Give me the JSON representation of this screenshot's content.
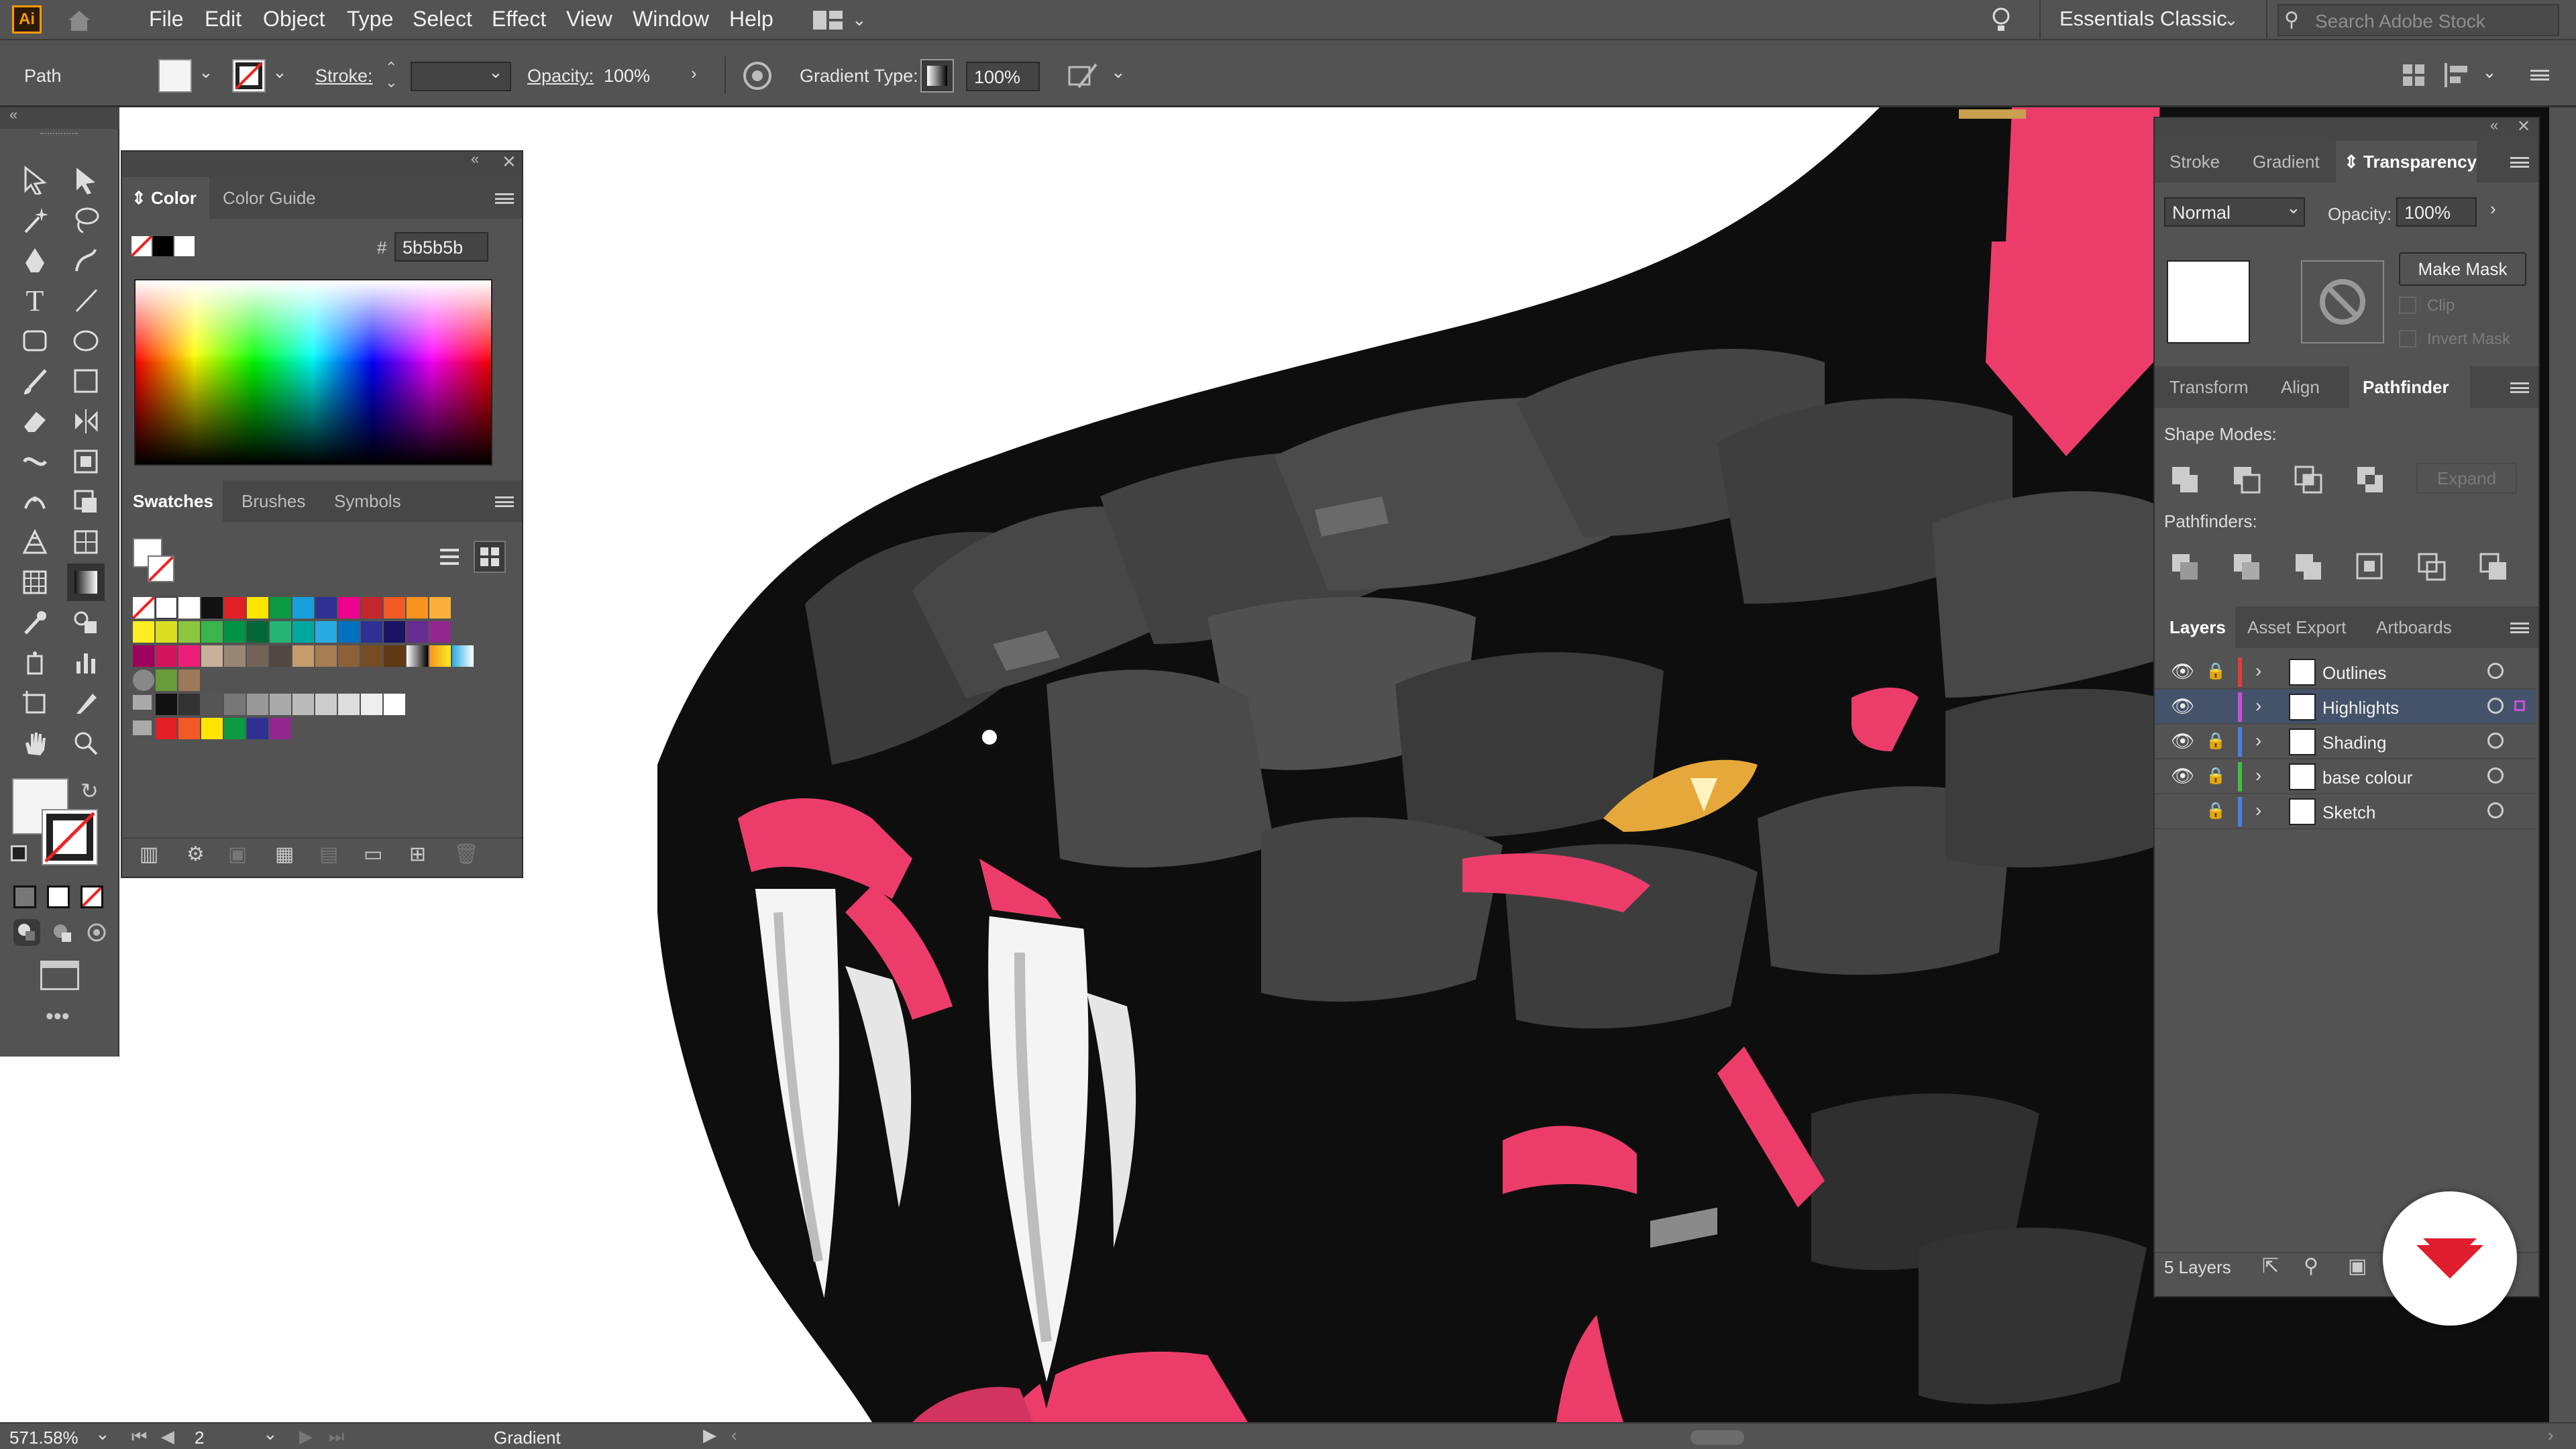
{
  "app": {
    "logo": "Ai"
  },
  "menu": [
    "File",
    "Edit",
    "Object",
    "Type",
    "Select",
    "Effect",
    "View",
    "Window",
    "Help"
  ],
  "workspace": {
    "name": "Essentials Classic",
    "search_placeholder": "Search Adobe Stock"
  },
  "control": {
    "selection": "Path",
    "stroke_label": "Stroke:",
    "opacity_label": "Opacity:",
    "opacity_value": "100%",
    "gradient_type_label": "Gradient Type:",
    "gradient_opacity": "100%"
  },
  "color_panel": {
    "tabs": [
      "Color",
      "Color Guide"
    ],
    "hex_label": "#",
    "hex_value": "5b5b5b"
  },
  "swatches_panel": {
    "tabs": [
      "Swatches",
      "Brushes",
      "Symbols"
    ]
  },
  "transparency_panel": {
    "tabs": [
      "Stroke",
      "Gradient",
      "Transparency"
    ],
    "blend_mode": "Normal",
    "opacity_label": "Opacity:",
    "opacity_value": "100%",
    "make_mask": "Make Mask",
    "clip": "Clip",
    "invert_mask": "Invert Mask"
  },
  "pathfinder_panel": {
    "tabs": [
      "Transform",
      "Align",
      "Pathfinder"
    ],
    "shape_modes_label": "Shape Modes:",
    "expand": "Expand",
    "pathfinders_label": "Pathfinders:"
  },
  "layers_panel": {
    "tabs": [
      "Layers",
      "Asset Export",
      "Artboards"
    ],
    "layers": [
      {
        "name": "Outlines",
        "color": "#e23b3b",
        "visible": true,
        "locked": true
      },
      {
        "name": "Highlights",
        "color": "#c94fd8",
        "visible": true,
        "locked": false
      },
      {
        "name": "Shading",
        "color": "#4a7fe6",
        "visible": true,
        "locked": true
      },
      {
        "name": "base colour",
        "color": "#3fbf3f",
        "visible": true,
        "locked": true
      },
      {
        "name": "Sketch",
        "color": "#4a7fe6",
        "visible": false,
        "locked": true
      }
    ],
    "count": "5 Layers"
  },
  "status": {
    "zoom": "571.58%",
    "artboard": "2",
    "tool": "Gradient"
  },
  "colors": {
    "accent": "#ec3d6a",
    "dark": "#2a2a2a",
    "eye": "#e6a83a"
  }
}
